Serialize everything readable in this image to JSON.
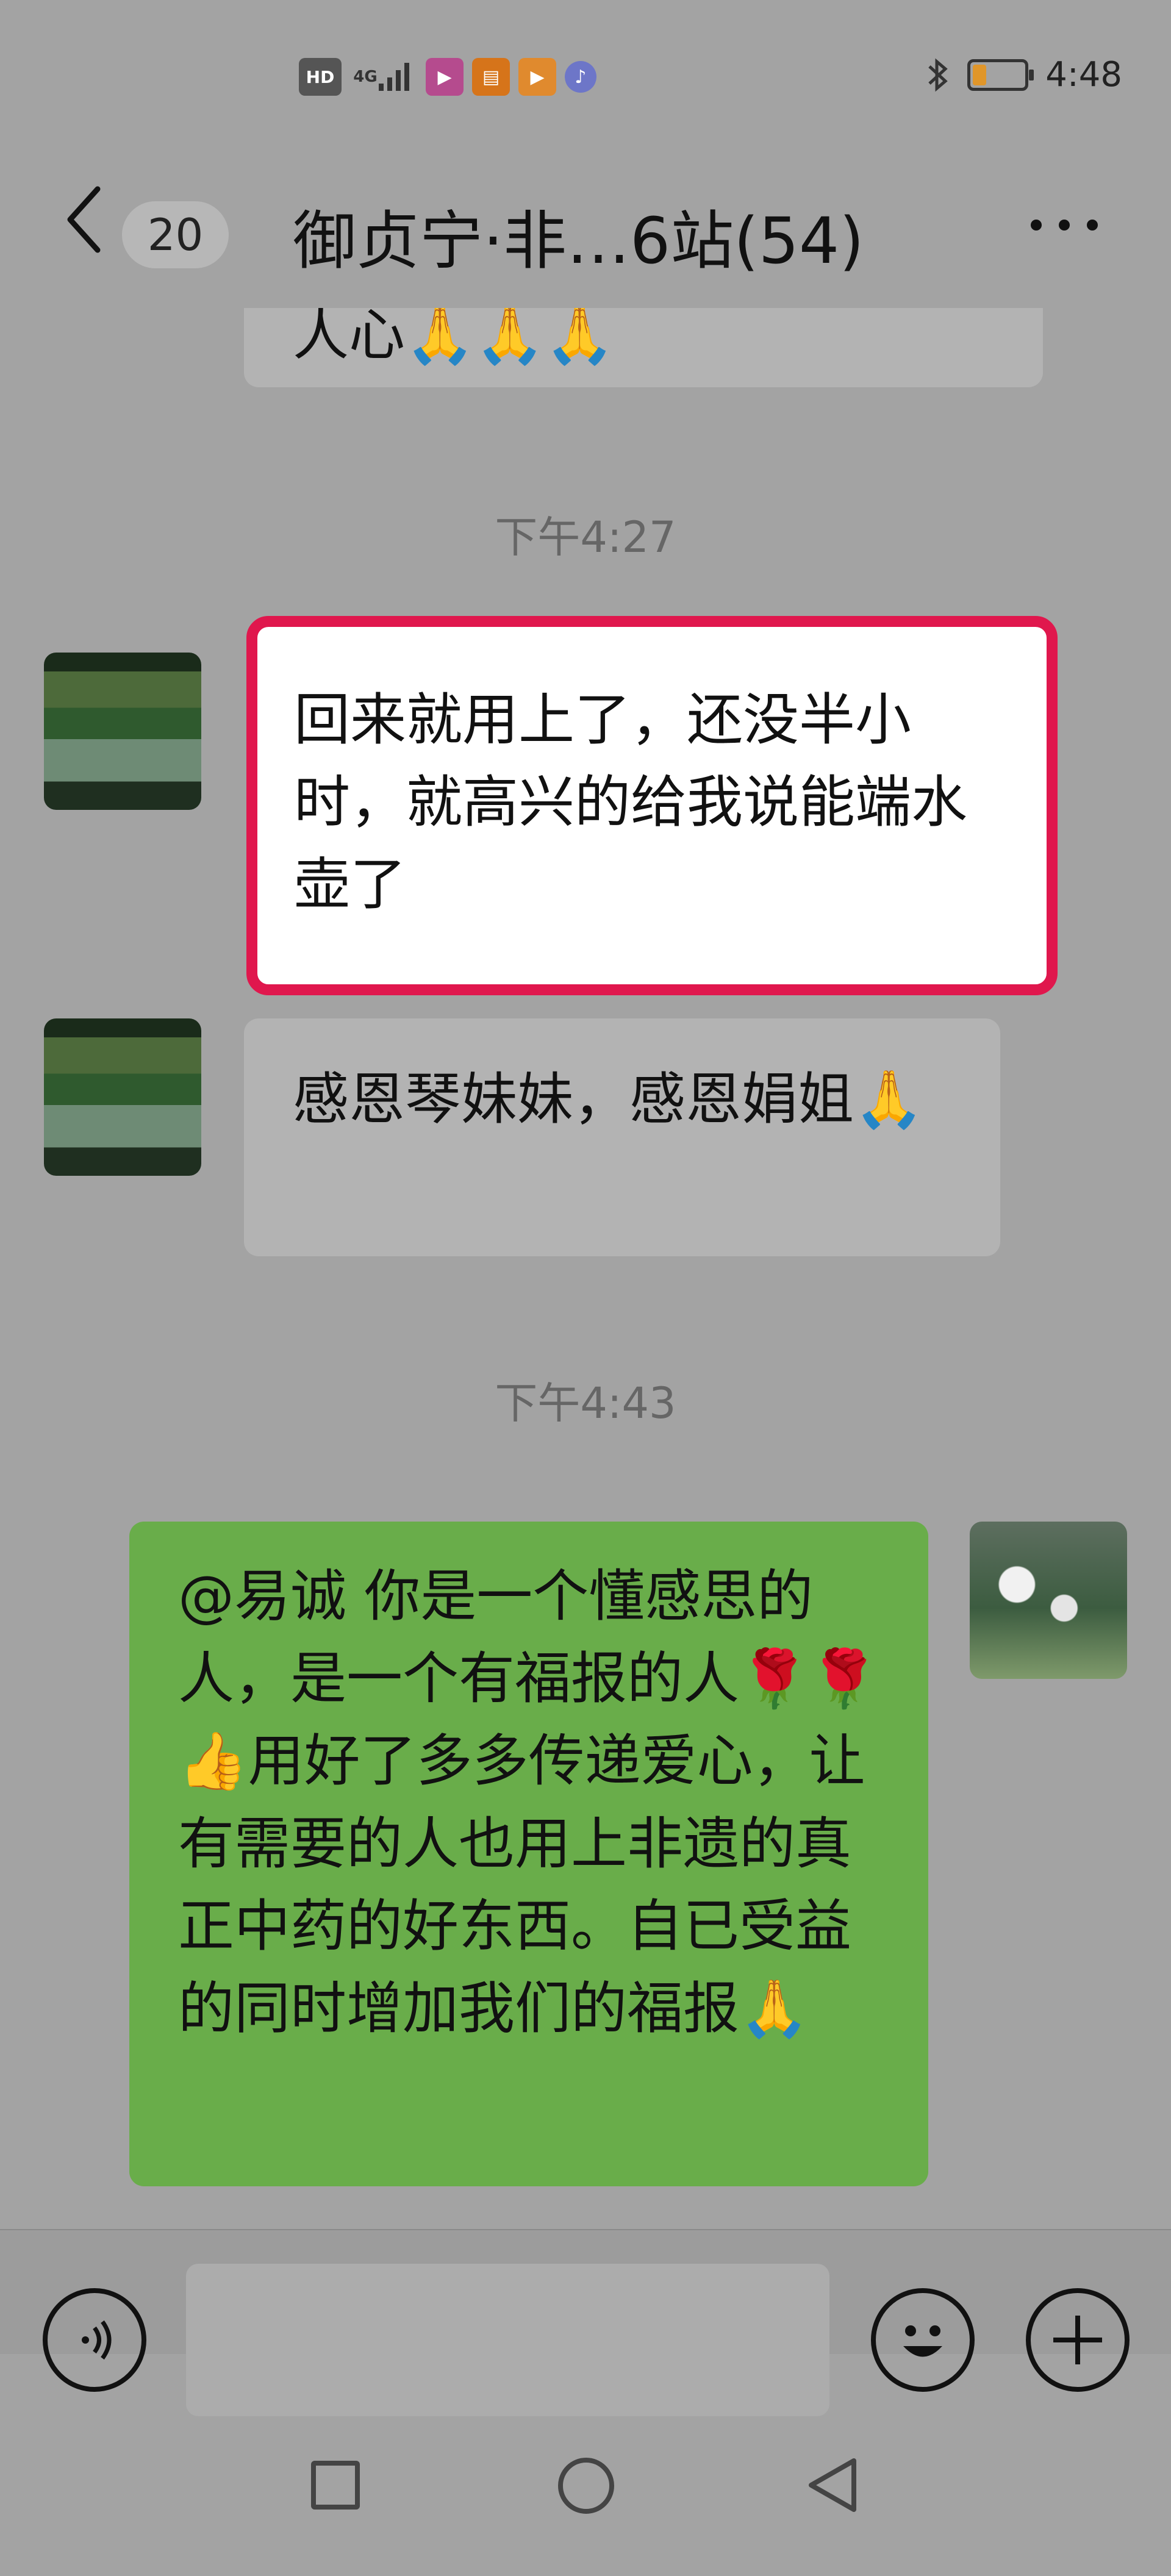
{
  "status_bar": {
    "network_label": "4G",
    "time": "4:48",
    "indicators": [
      "HD",
      "signal-icon",
      "video-app-icon",
      "shop-app-icon",
      "video-app-icon",
      "music-icon",
      "bluetooth-icon",
      "battery-icon"
    ]
  },
  "header": {
    "unread_count": "20",
    "title": "御贞宁·非…6站(54)"
  },
  "messages": [
    {
      "type": "partial_incoming",
      "text": "人心🙏🙏🙏"
    },
    {
      "type": "timestamp",
      "text": "下午4:27"
    },
    {
      "type": "incoming",
      "text": "回来就用上了，还没半小时，就高兴的给我说能端水壶了",
      "highlighted": true
    },
    {
      "type": "incoming",
      "text": "感恩琴妹妹，感恩娟姐🙏"
    },
    {
      "type": "timestamp",
      "text": "下午4:43"
    },
    {
      "type": "outgoing",
      "text": "@易诚  你是一个懂感思的人，是一个有福报的人🌹🌹👍用好了多多传递爱心，让有需要的人也用上非遗的真正中药的好东西。自已受益的同时增加我们的福报🙏"
    }
  ],
  "input": {
    "placeholder": ""
  },
  "colors": {
    "background": "#a3a3a3",
    "incoming_bubble": "#b3b3b3",
    "outgoing_bubble": "#69ad4a",
    "highlight_border": "#e0174d"
  }
}
